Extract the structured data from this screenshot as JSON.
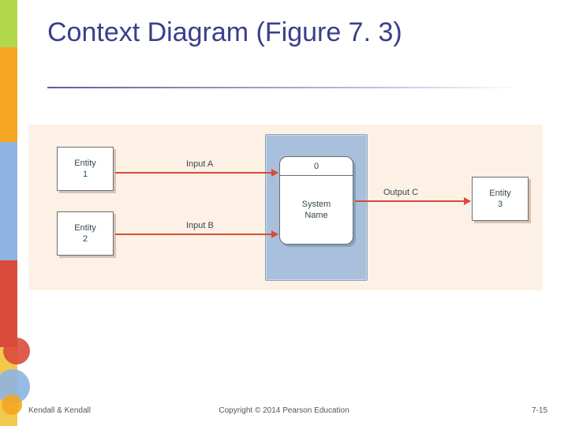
{
  "title": "Context Diagram (Figure 7. 3)",
  "entities": {
    "e1": {
      "name": "Entity",
      "num": "1"
    },
    "e2": {
      "name": "Entity",
      "num": "2"
    },
    "e3": {
      "name": "Entity",
      "num": "3"
    }
  },
  "process": {
    "id": "0",
    "name_line1": "System",
    "name_line2": "Name"
  },
  "flows": {
    "a": "Input A",
    "b": "Input B",
    "c": "Output C"
  },
  "footer": {
    "left": "Kendall & Kendall",
    "center": "Copyright © 2014 Pearson Education",
    "right": "7-15"
  }
}
